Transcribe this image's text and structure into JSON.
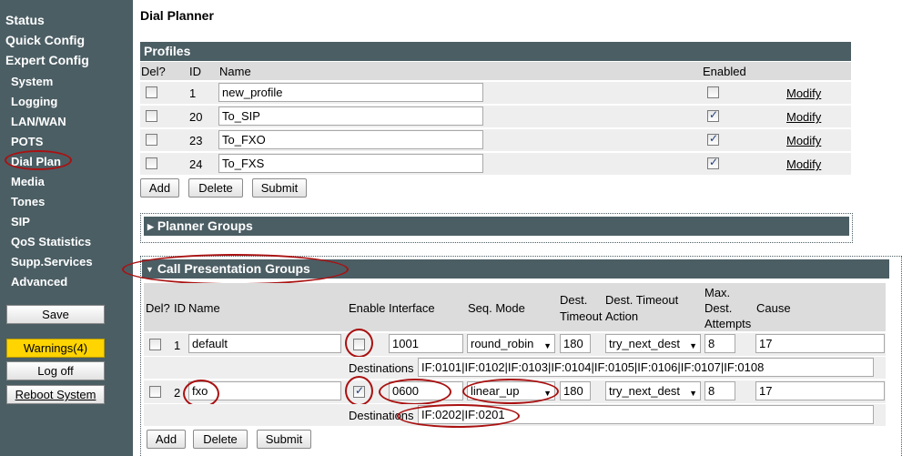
{
  "sidebar": {
    "status": "Status",
    "quick_config": "Quick Config",
    "expert_config": "Expert Config",
    "items": [
      "System",
      "Logging",
      "LAN/WAN",
      "POTS",
      "Dial Plan",
      "Media",
      "Tones",
      "SIP",
      "QoS Statistics",
      "Supp.Services",
      "Advanced"
    ],
    "save": "Save",
    "warnings": "Warnings(4)",
    "logoff": "Log off",
    "reboot": "Reboot System"
  },
  "page": {
    "title": "Dial Planner"
  },
  "profiles": {
    "title": "Profiles",
    "headers": {
      "del": "Del?",
      "id": "ID",
      "name": "Name",
      "enabled": "Enabled"
    },
    "rows": [
      {
        "id": "1",
        "name": "new_profile",
        "enabled": false,
        "action": "Modify"
      },
      {
        "id": "20",
        "name": "To_SIP",
        "enabled": true,
        "action": "Modify"
      },
      {
        "id": "23",
        "name": "To_FXO",
        "enabled": true,
        "action": "Modify"
      },
      {
        "id": "24",
        "name": "To_FXS",
        "enabled": true,
        "action": "Modify"
      }
    ],
    "buttons": {
      "add": "Add",
      "delete": "Delete",
      "submit": "Submit"
    }
  },
  "planner_groups": {
    "title": "Planner Groups",
    "expanded": false
  },
  "call_presentation": {
    "title": "Call Presentation Groups",
    "expanded": true,
    "headers": {
      "del": "Del?",
      "id": "ID",
      "name": "Name",
      "enable": "Enable",
      "interface": "Interface",
      "seq_mode": "Seq. Mode",
      "dest_timeout_1": "Dest.",
      "dest_timeout_2": "Timeout",
      "timeout_action_1": "Dest. Timeout",
      "timeout_action_2": "Action",
      "max_attempts_1": "Max.",
      "max_attempts_2": "Dest.",
      "max_attempts_3": "Attempts",
      "cause": "Cause"
    },
    "destinations_label": "Destinations",
    "rows": [
      {
        "id": "1",
        "name": "default",
        "enable": false,
        "interface": "1001",
        "seq_mode": "round_robin",
        "timeout": "180",
        "timeout_action": "try_next_dest",
        "max_attempts": "8",
        "cause": "17",
        "destinations": "IF:0101|IF:0102|IF:0103|IF:0104|IF:0105|IF:0106|IF:0107|IF:0108"
      },
      {
        "id": "2",
        "name": "fxo",
        "enable": true,
        "interface": "0600",
        "seq_mode": "linear_up",
        "timeout": "180",
        "timeout_action": "try_next_dest",
        "max_attempts": "8",
        "cause": "17",
        "destinations": "IF:0202|IF:0201"
      }
    ],
    "buttons": {
      "add": "Add",
      "delete": "Delete",
      "submit": "Submit"
    }
  },
  "colors": {
    "sidebar_bg": "#4b5e64",
    "header_bg": "#dcdcdc",
    "row_bg": "#eeeeee",
    "warning_bg": "#ffd400",
    "annotation": "#a11111"
  }
}
